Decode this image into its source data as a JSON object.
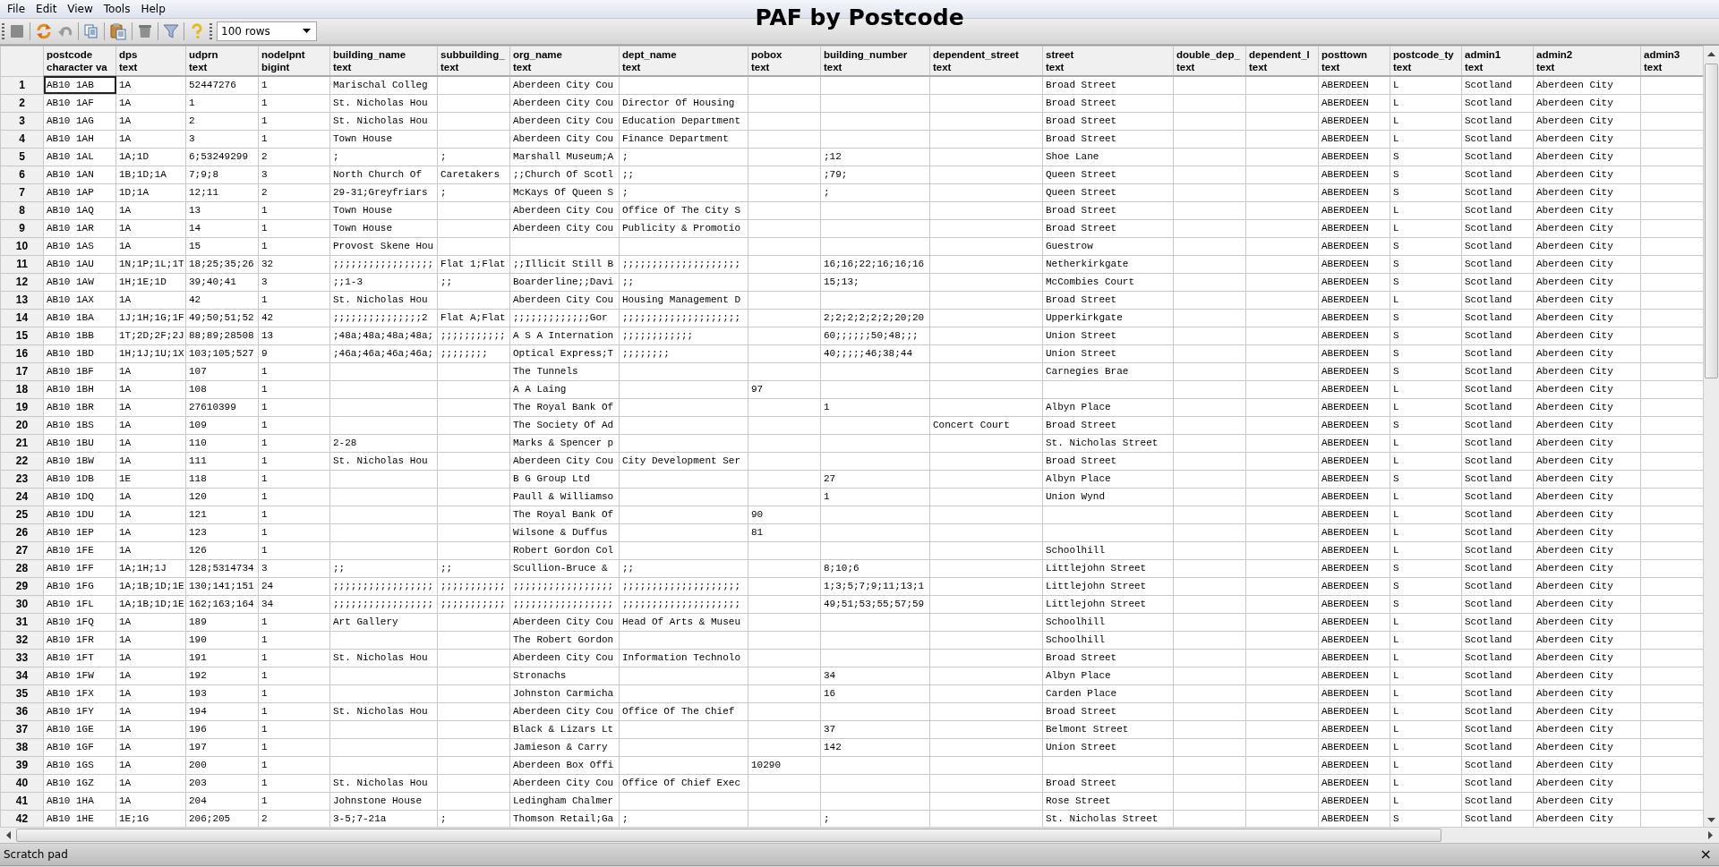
{
  "menu": [
    "File",
    "Edit",
    "View",
    "Tools",
    "Help"
  ],
  "toolbar": {
    "rows_limit": "100 rows"
  },
  "title": "PAF by Postcode",
  "columns": [
    {
      "name": "postcode",
      "type": "character va"
    },
    {
      "name": "dps",
      "type": "text"
    },
    {
      "name": "udprn",
      "type": "text"
    },
    {
      "name": "nodelpnt",
      "type": "bigint"
    },
    {
      "name": "building_name",
      "type": "text"
    },
    {
      "name": "subbuilding_",
      "type": "text"
    },
    {
      "name": "org_name",
      "type": "text"
    },
    {
      "name": "dept_name",
      "type": "text"
    },
    {
      "name": "pobox",
      "type": "text"
    },
    {
      "name": "building_number",
      "type": "text"
    },
    {
      "name": "dependent_street",
      "type": "text"
    },
    {
      "name": "street",
      "type": "text"
    },
    {
      "name": "double_dep_",
      "type": "text"
    },
    {
      "name": "dependent_l",
      "type": "text"
    },
    {
      "name": "posttown",
      "type": "text"
    },
    {
      "name": "postcode_ty",
      "type": "text"
    },
    {
      "name": "admin1",
      "type": "text"
    },
    {
      "name": "admin2",
      "type": "text"
    },
    {
      "name": "admin3",
      "type": "text"
    }
  ],
  "rows": [
    {
      "number": "1",
      "selected": true,
      "cells": [
        "AB10 1AB",
        "1A",
        "52447276",
        "1",
        "Marischal Colleg",
        null,
        "Aberdeen City Cou",
        null,
        null,
        null,
        null,
        "Broad Street",
        null,
        null,
        "ABERDEEN",
        "L",
        "Scotland",
        "Aberdeen City",
        null
      ]
    },
    {
      "number": "2",
      "selected": false,
      "cells": [
        "AB10 1AF",
        "1A",
        "1",
        "1",
        "St. Nicholas Hou",
        null,
        "Aberdeen City Cou",
        "Director Of Housing",
        null,
        null,
        null,
        "Broad Street",
        null,
        null,
        "ABERDEEN",
        "L",
        "Scotland",
        "Aberdeen City",
        null
      ]
    },
    {
      "number": "3",
      "selected": false,
      "cells": [
        "AB10 1AG",
        "1A",
        "2",
        "1",
        "St. Nicholas Hou",
        null,
        "Aberdeen City Cou",
        "Education Department",
        null,
        null,
        null,
        "Broad Street",
        null,
        null,
        "ABERDEEN",
        "L",
        "Scotland",
        "Aberdeen City",
        null
      ]
    },
    {
      "number": "4",
      "selected": false,
      "cells": [
        "AB10 1AH",
        "1A",
        "3",
        "1",
        "Town House",
        null,
        "Aberdeen City Cou",
        "Finance Department",
        null,
        null,
        null,
        "Broad Street",
        null,
        null,
        "ABERDEEN",
        "L",
        "Scotland",
        "Aberdeen City",
        null
      ]
    },
    {
      "number": "5",
      "selected": false,
      "cells": [
        "AB10 1AL",
        "1A;1D",
        "6;53249299",
        "2",
        ";",
        ";",
        "Marshall Museum;A",
        ";",
        null,
        ";12",
        null,
        "Shoe Lane",
        null,
        null,
        "ABERDEEN",
        "S",
        "Scotland",
        "Aberdeen City",
        null
      ]
    },
    {
      "number": "6",
      "selected": false,
      "cells": [
        "AB10 1AN",
        "1B;1D;1A",
        "7;9;8",
        "3",
        "North Church Of",
        "Caretakers",
        ";;Church Of Scotl",
        ";;",
        null,
        ";79;",
        null,
        "Queen Street",
        null,
        null,
        "ABERDEEN",
        "S",
        "Scotland",
        "Aberdeen City",
        null
      ]
    },
    {
      "number": "7",
      "selected": false,
      "cells": [
        "AB10 1AP",
        "1D;1A",
        "12;11",
        "2",
        "29-31;Greyfriars",
        ";",
        "McKays Of Queen S",
        ";",
        null,
        ";",
        null,
        "Queen Street",
        null,
        null,
        "ABERDEEN",
        "S",
        "Scotland",
        "Aberdeen City",
        null
      ]
    },
    {
      "number": "8",
      "selected": false,
      "cells": [
        "AB10 1AQ",
        "1A",
        "13",
        "1",
        "Town House",
        null,
        "Aberdeen City Cou",
        "Office Of The City S",
        null,
        null,
        null,
        "Broad Street",
        null,
        null,
        "ABERDEEN",
        "L",
        "Scotland",
        "Aberdeen City",
        null
      ]
    },
    {
      "number": "9",
      "selected": false,
      "cells": [
        "AB10 1AR",
        "1A",
        "14",
        "1",
        "Town House",
        null,
        "Aberdeen City Cou",
        "Publicity & Promotio",
        null,
        null,
        null,
        "Broad Street",
        null,
        null,
        "ABERDEEN",
        "L",
        "Scotland",
        "Aberdeen City",
        null
      ]
    },
    {
      "number": "10",
      "selected": false,
      "cells": [
        "AB10 1AS",
        "1A",
        "15",
        "1",
        "Provost Skene Hou",
        null,
        null,
        null,
        null,
        null,
        null,
        "Guestrow",
        null,
        null,
        "ABERDEEN",
        "S",
        "Scotland",
        "Aberdeen City",
        null
      ]
    },
    {
      "number": "11",
      "selected": false,
      "cells": [
        "AB10 1AU",
        "1N;1P;1L;1T",
        "18;25;35;26",
        "32",
        ";;;;;;;;;;;;;;;;;",
        "Flat 1;Flat",
        ";;Illicit Still B",
        ";;;;;;;;;;;;;;;;;;;;",
        null,
        "16;16;22;16;16;16",
        null,
        "Netherkirkgate",
        null,
        null,
        "ABERDEEN",
        "S",
        "Scotland",
        "Aberdeen City",
        null
      ]
    },
    {
      "number": "12",
      "selected": false,
      "cells": [
        "AB10 1AW",
        "1H;1E;1D",
        "39;40;41",
        "3",
        ";;1-3",
        ";;",
        "Boarderline;;Davi",
        ";;",
        null,
        "15;13;",
        null,
        "McCombies Court",
        null,
        null,
        "ABERDEEN",
        "S",
        "Scotland",
        "Aberdeen City",
        null
      ]
    },
    {
      "number": "13",
      "selected": false,
      "cells": [
        "AB10 1AX",
        "1A",
        "42",
        "1",
        "St. Nicholas Hou",
        null,
        "Aberdeen City Cou",
        "Housing Management D",
        null,
        null,
        null,
        "Broad Street",
        null,
        null,
        "ABERDEEN",
        "L",
        "Scotland",
        "Aberdeen City",
        null
      ]
    },
    {
      "number": "14",
      "selected": false,
      "cells": [
        "AB10 1BA",
        "1J;1H;1G;1F",
        "49;50;51;52",
        "42",
        ";;;;;;;;;;;;;;;2",
        "Flat A;Flat",
        ";;;;;;;;;;;;;Gor",
        ";;;;;;;;;;;;;;;;;;;;",
        null,
        "2;2;2;2;2;2;20;20",
        null,
        "Upperkirkgate",
        null,
        null,
        "ABERDEEN",
        "S",
        "Scotland",
        "Aberdeen City",
        null
      ]
    },
    {
      "number": "15",
      "selected": false,
      "cells": [
        "AB10 1BB",
        "1T;2D;2F;2J",
        "88;89;28508",
        "13",
        ";48a;48a;48a;48a;",
        ";;;;;;;;;;;",
        "A S A Internation",
        ";;;;;;;;;;;;",
        null,
        "60;;;;;;50;48;;;",
        null,
        "Union Street",
        null,
        null,
        "ABERDEEN",
        "S",
        "Scotland",
        "Aberdeen City",
        null
      ]
    },
    {
      "number": "16",
      "selected": false,
      "cells": [
        "AB10 1BD",
        "1H;1J;1U;1X",
        "103;105;527",
        "9",
        ";46a;46a;46a;46a;",
        ";;;;;;;;",
        "Optical Express;T",
        ";;;;;;;;",
        null,
        "40;;;;;46;38;44",
        null,
        "Union Street",
        null,
        null,
        "ABERDEEN",
        "S",
        "Scotland",
        "Aberdeen City",
        null
      ]
    },
    {
      "number": "17",
      "selected": false,
      "cells": [
        "AB10 1BF",
        "1A",
        "107",
        "1",
        null,
        null,
        "The Tunnels",
        null,
        null,
        null,
        null,
        "Carnegies Brae",
        null,
        null,
        "ABERDEEN",
        "S",
        "Scotland",
        "Aberdeen City",
        null
      ]
    },
    {
      "number": "18",
      "selected": false,
      "cells": [
        "AB10 1BH",
        "1A",
        "108",
        "1",
        null,
        null,
        "A A Laing",
        null,
        "97",
        null,
        null,
        null,
        null,
        null,
        "ABERDEEN",
        "L",
        "Scotland",
        "Aberdeen City",
        null
      ]
    },
    {
      "number": "19",
      "selected": false,
      "cells": [
        "AB10 1BR",
        "1A",
        "27610399",
        "1",
        null,
        null,
        "The Royal Bank Of",
        null,
        null,
        "1",
        null,
        "Albyn Place",
        null,
        null,
        "ABERDEEN",
        "L",
        "Scotland",
        "Aberdeen City",
        null
      ]
    },
    {
      "number": "20",
      "selected": false,
      "cells": [
        "AB10 1BS",
        "1A",
        "109",
        "1",
        null,
        null,
        "The Society Of Ad",
        null,
        null,
        null,
        "Concert Court",
        "Broad Street",
        null,
        null,
        "ABERDEEN",
        "S",
        "Scotland",
        "Aberdeen City",
        null
      ]
    },
    {
      "number": "21",
      "selected": false,
      "cells": [
        "AB10 1BU",
        "1A",
        "110",
        "1",
        "2-28",
        null,
        "Marks & Spencer p",
        null,
        null,
        null,
        null,
        "St. Nicholas Street",
        null,
        null,
        "ABERDEEN",
        "L",
        "Scotland",
        "Aberdeen City",
        null
      ]
    },
    {
      "number": "22",
      "selected": false,
      "cells": [
        "AB10 1BW",
        "1A",
        "111",
        "1",
        "St. Nicholas Hou",
        null,
        "Aberdeen City Cou",
        "City Development Ser",
        null,
        null,
        null,
        "Broad Street",
        null,
        null,
        "ABERDEEN",
        "L",
        "Scotland",
        "Aberdeen City",
        null
      ]
    },
    {
      "number": "23",
      "selected": false,
      "cells": [
        "AB10 1DB",
        "1E",
        "118",
        "1",
        null,
        null,
        "B G Group Ltd",
        null,
        null,
        "27",
        null,
        "Albyn Place",
        null,
        null,
        "ABERDEEN",
        "S",
        "Scotland",
        "Aberdeen City",
        null
      ]
    },
    {
      "number": "24",
      "selected": false,
      "cells": [
        "AB10 1DQ",
        "1A",
        "120",
        "1",
        null,
        null,
        "Paull & Williamso",
        null,
        null,
        "1",
        null,
        "Union Wynd",
        null,
        null,
        "ABERDEEN",
        "L",
        "Scotland",
        "Aberdeen City",
        null
      ]
    },
    {
      "number": "25",
      "selected": false,
      "cells": [
        "AB10 1DU",
        "1A",
        "121",
        "1",
        null,
        null,
        "The Royal Bank Of",
        null,
        "90",
        null,
        null,
        null,
        null,
        null,
        "ABERDEEN",
        "L",
        "Scotland",
        "Aberdeen City",
        null
      ]
    },
    {
      "number": "26",
      "selected": false,
      "cells": [
        "AB10 1EP",
        "1A",
        "123",
        "1",
        null,
        null,
        "Wilsone & Duffus",
        null,
        "81",
        null,
        null,
        null,
        null,
        null,
        "ABERDEEN",
        "L",
        "Scotland",
        "Aberdeen City",
        null
      ]
    },
    {
      "number": "27",
      "selected": false,
      "cells": [
        "AB10 1FE",
        "1A",
        "126",
        "1",
        null,
        null,
        "Robert Gordon Col",
        null,
        null,
        null,
        null,
        "Schoolhill",
        null,
        null,
        "ABERDEEN",
        "L",
        "Scotland",
        "Aberdeen City",
        null
      ]
    },
    {
      "number": "28",
      "selected": false,
      "cells": [
        "AB10 1FF",
        "1A;1H;1J",
        "128;5314734",
        "3",
        ";;",
        ";;",
        "Scullion-Bruce &",
        ";;",
        null,
        "8;10;6",
        null,
        "Littlejohn Street",
        null,
        null,
        "ABERDEEN",
        "S",
        "Scotland",
        "Aberdeen City",
        null
      ]
    },
    {
      "number": "29",
      "selected": false,
      "cells": [
        "AB10 1FG",
        "1A;1B;1D;1E",
        "130;141;151",
        "24",
        ";;;;;;;;;;;;;;;;;",
        ";;;;;;;;;;;",
        ";;;;;;;;;;;;;;;;;",
        ";;;;;;;;;;;;;;;;;;;;",
        null,
        "1;3;5;7;9;11;13;1",
        null,
        "Littlejohn Street",
        null,
        null,
        "ABERDEEN",
        "S",
        "Scotland",
        "Aberdeen City",
        null
      ]
    },
    {
      "number": "30",
      "selected": false,
      "cells": [
        "AB10 1FL",
        "1A;1B;1D;1E",
        "162;163;164",
        "34",
        ";;;;;;;;;;;;;;;;;",
        ";;;;;;;;;;;",
        ";;;;;;;;;;;;;;;;;",
        ";;;;;;;;;;;;;;;;;;;;",
        null,
        "49;51;53;55;57;59",
        null,
        "Littlejohn Street",
        null,
        null,
        "ABERDEEN",
        "S",
        "Scotland",
        "Aberdeen City",
        null
      ]
    },
    {
      "number": "31",
      "selected": false,
      "cells": [
        "AB10 1FQ",
        "1A",
        "189",
        "1",
        "Art Gallery",
        null,
        "Aberdeen City Cou",
        "Head Of Arts & Museu",
        null,
        null,
        null,
        "Schoolhill",
        null,
        null,
        "ABERDEEN",
        "L",
        "Scotland",
        "Aberdeen City",
        null
      ]
    },
    {
      "number": "32",
      "selected": false,
      "cells": [
        "AB10 1FR",
        "1A",
        "190",
        "1",
        null,
        null,
        "The Robert Gordon",
        null,
        null,
        null,
        null,
        "Schoolhill",
        null,
        null,
        "ABERDEEN",
        "L",
        "Scotland",
        "Aberdeen City",
        null
      ]
    },
    {
      "number": "33",
      "selected": false,
      "cells": [
        "AB10 1FT",
        "1A",
        "191",
        "1",
        "St. Nicholas Hou",
        null,
        "Aberdeen City Cou",
        "Information Technolo",
        null,
        null,
        null,
        "Broad Street",
        null,
        null,
        "ABERDEEN",
        "L",
        "Scotland",
        "Aberdeen City",
        null
      ]
    },
    {
      "number": "34",
      "selected": false,
      "cells": [
        "AB10 1FW",
        "1A",
        "192",
        "1",
        null,
        null,
        "Stronachs",
        null,
        null,
        "34",
        null,
        "Albyn Place",
        null,
        null,
        "ABERDEEN",
        "L",
        "Scotland",
        "Aberdeen City",
        null
      ]
    },
    {
      "number": "35",
      "selected": false,
      "cells": [
        "AB10 1FX",
        "1A",
        "193",
        "1",
        null,
        null,
        "Johnston Carmicha",
        null,
        null,
        "16",
        null,
        "Carden Place",
        null,
        null,
        "ABERDEEN",
        "L",
        "Scotland",
        "Aberdeen City",
        null
      ]
    },
    {
      "number": "36",
      "selected": false,
      "cells": [
        "AB10 1FY",
        "1A",
        "194",
        "1",
        "St. Nicholas Hou",
        null,
        "Aberdeen City Cou",
        "Office Of The Chief",
        null,
        null,
        null,
        "Broad Street",
        null,
        null,
        "ABERDEEN",
        "L",
        "Scotland",
        "Aberdeen City",
        null
      ]
    },
    {
      "number": "37",
      "selected": false,
      "cells": [
        "AB10 1GE",
        "1A",
        "196",
        "1",
        null,
        null,
        "Black & Lizars Lt",
        null,
        null,
        "37",
        null,
        "Belmont Street",
        null,
        null,
        "ABERDEEN",
        "L",
        "Scotland",
        "Aberdeen City",
        null
      ]
    },
    {
      "number": "38",
      "selected": false,
      "cells": [
        "AB10 1GF",
        "1A",
        "197",
        "1",
        null,
        null,
        "Jamieson & Carry",
        null,
        null,
        "142",
        null,
        "Union Street",
        null,
        null,
        "ABERDEEN",
        "L",
        "Scotland",
        "Aberdeen City",
        null
      ]
    },
    {
      "number": "39",
      "selected": false,
      "cells": [
        "AB10 1GS",
        "1A",
        "200",
        "1",
        null,
        null,
        "Aberdeen Box Offi",
        null,
        "10290",
        null,
        null,
        null,
        null,
        null,
        "ABERDEEN",
        "L",
        "Scotland",
        "Aberdeen City",
        null
      ]
    },
    {
      "number": "40",
      "selected": false,
      "cells": [
        "AB10 1GZ",
        "1A",
        "203",
        "1",
        "St. Nicholas Hou",
        null,
        "Aberdeen City Cou",
        "Office Of Chief Exec",
        null,
        null,
        null,
        "Broad Street",
        null,
        null,
        "ABERDEEN",
        "L",
        "Scotland",
        "Aberdeen City",
        null
      ]
    },
    {
      "number": "41",
      "selected": false,
      "cells": [
        "AB10 1HA",
        "1A",
        "204",
        "1",
        "Johnstone House",
        null,
        "Ledingham Chalmer",
        null,
        null,
        null,
        null,
        "Rose Street",
        null,
        null,
        "ABERDEEN",
        "L",
        "Scotland",
        "Aberdeen City",
        null
      ]
    },
    {
      "number": "42",
      "selected": false,
      "cells": [
        "AB10 1HE",
        "1E;1G",
        "206;205",
        "2",
        "3-5;7-21a",
        ";",
        "Thomson Retail;Ga",
        ";",
        null,
        ";",
        null,
        "St. Nicholas Street",
        null,
        null,
        "ABERDEEN",
        "S",
        "Scotland",
        "Aberdeen City",
        null
      ]
    }
  ],
  "scratch_pad": {
    "title": "Scratch pad",
    "close": "×"
  }
}
